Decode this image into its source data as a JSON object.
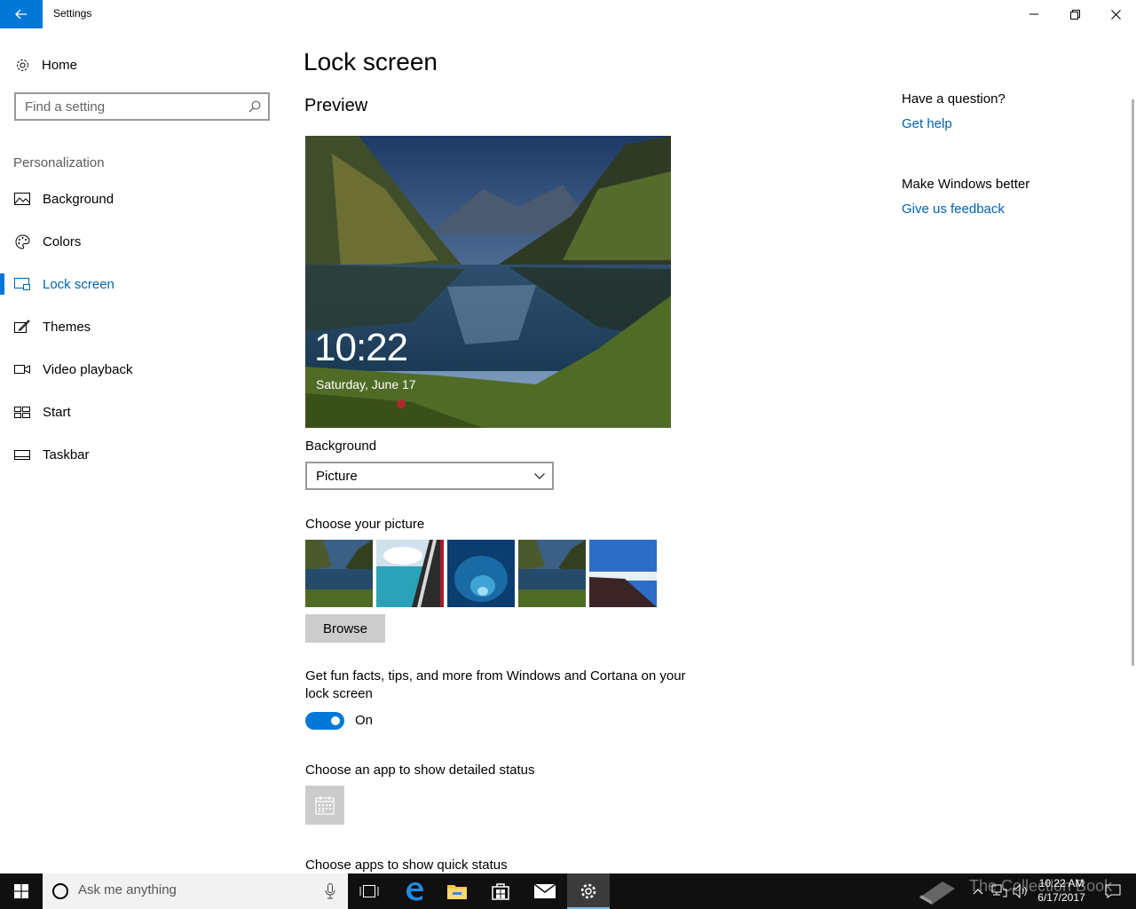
{
  "window": {
    "title": "Settings"
  },
  "sidebar": {
    "home_label": "Home",
    "search_placeholder": "Find a setting",
    "section_label": "Personalization",
    "items": [
      {
        "label": "Background",
        "icon": "picture-icon"
      },
      {
        "label": "Colors",
        "icon": "palette-icon"
      },
      {
        "label": "Lock screen",
        "icon": "lock-screen-icon",
        "active": true
      },
      {
        "label": "Themes",
        "icon": "brush-icon"
      },
      {
        "label": "Video playback",
        "icon": "video-icon"
      },
      {
        "label": "Start",
        "icon": "start-tiles-icon"
      },
      {
        "label": "Taskbar",
        "icon": "taskbar-icon"
      }
    ]
  },
  "main": {
    "title": "Lock screen",
    "preview_heading": "Preview",
    "preview_time": "10:22",
    "preview_date": "Saturday, June 17",
    "background_label": "Background",
    "background_value": "Picture",
    "choose_picture_label": "Choose your picture",
    "browse_label": "Browse",
    "fun_facts_text": "Get fun facts, tips, and more from Windows and Cortana on your lock screen",
    "toggle_state": "On",
    "detailed_status_label": "Choose an app to show detailed status",
    "quick_status_label": "Choose apps to show quick status"
  },
  "right_pane": {
    "question_heading": "Have a question?",
    "get_help": "Get help",
    "better_heading": "Make Windows better",
    "feedback": "Give us feedback"
  },
  "taskbar": {
    "search_placeholder": "Ask me anything",
    "clock_time": "10:22 AM",
    "clock_date": "6/17/2017",
    "watermark": "The Collection Book"
  },
  "colors": {
    "accent": "#0078d7",
    "link": "#0063b1",
    "taskbar": "#101010"
  }
}
